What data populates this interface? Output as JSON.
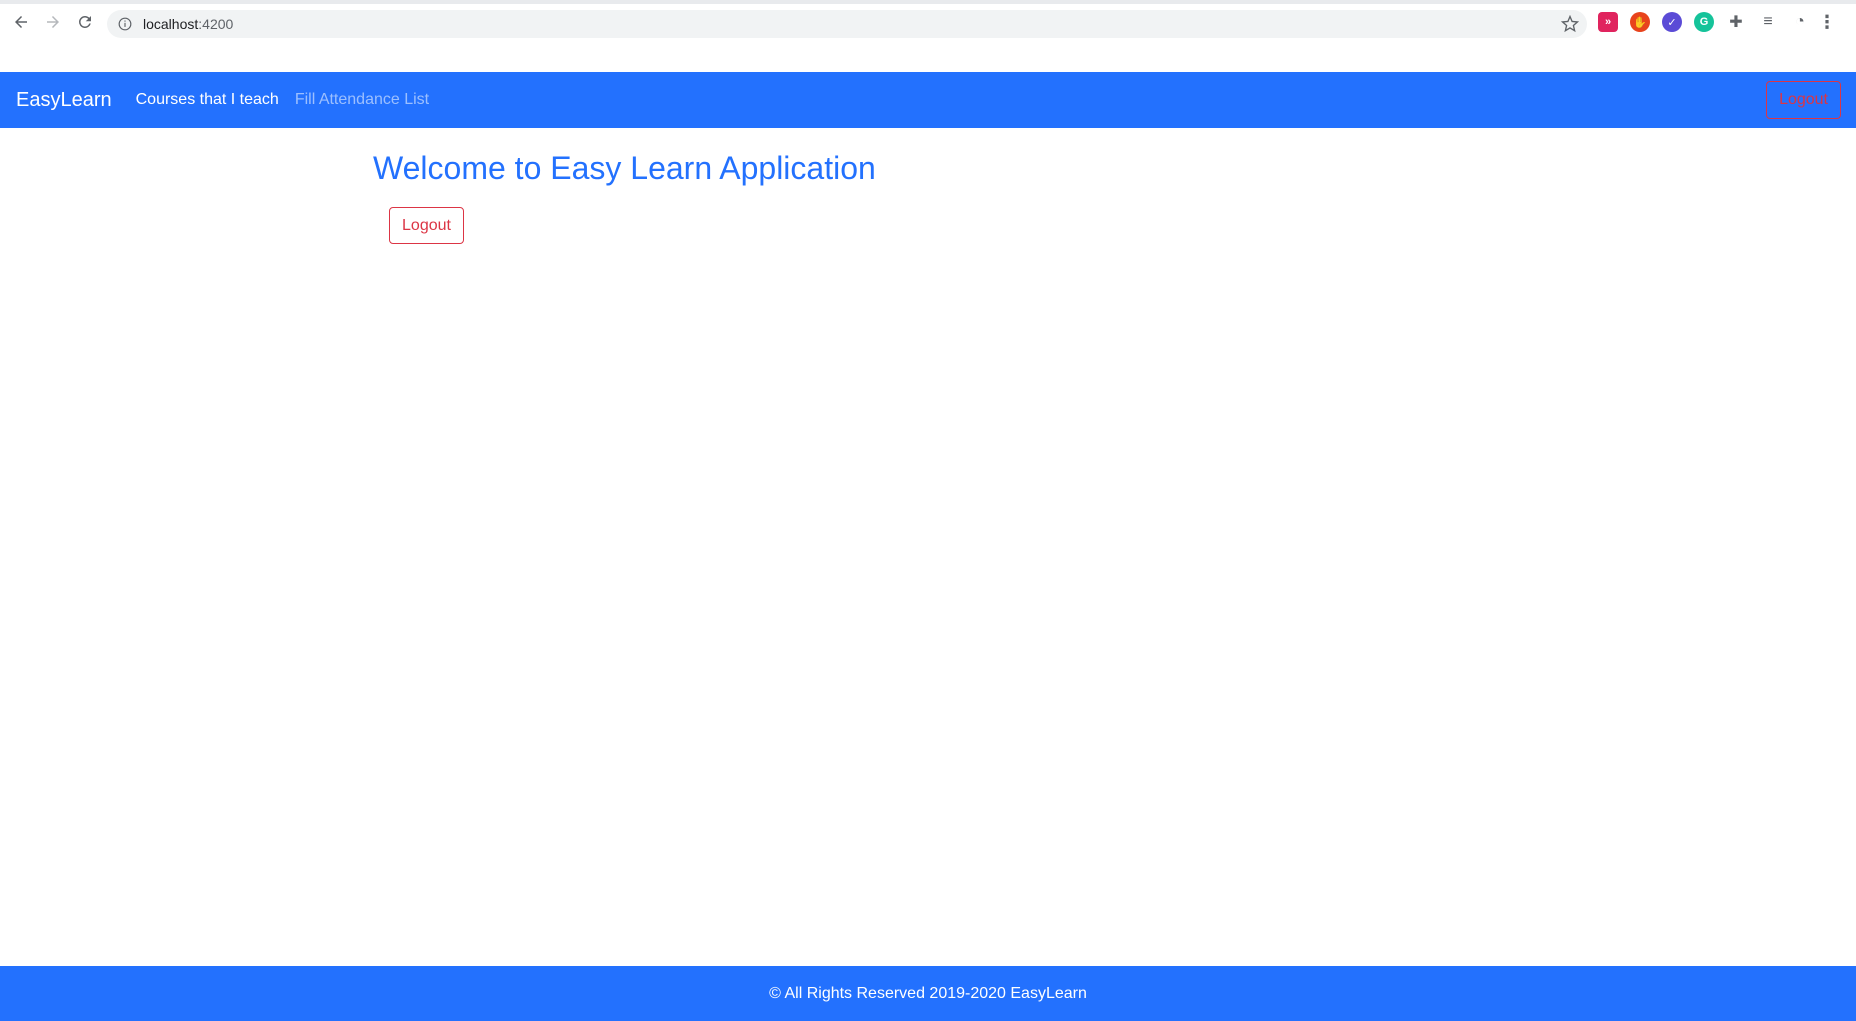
{
  "browser": {
    "url_host": "localhost",
    "url_port": ":4200",
    "icons": [
      "back-icon",
      "forward-icon",
      "reload-icon",
      "info-icon",
      "star-icon",
      "extensions-icon",
      "menu-icon"
    ]
  },
  "navbar": {
    "brand": "EasyLearn",
    "links": [
      {
        "label": "Courses that I teach"
      },
      {
        "label": "Fill Attendance List"
      }
    ],
    "logout_label": "Logout",
    "background": "#2371fe"
  },
  "main": {
    "title": "Welcome to Easy Learn Application",
    "logout_label": "Logout"
  },
  "footer": {
    "text": "© All Rights Reserved 2019-2020 EasyLearn"
  },
  "colors": {
    "primary": "#2371fe",
    "danger": "#dc3545"
  }
}
